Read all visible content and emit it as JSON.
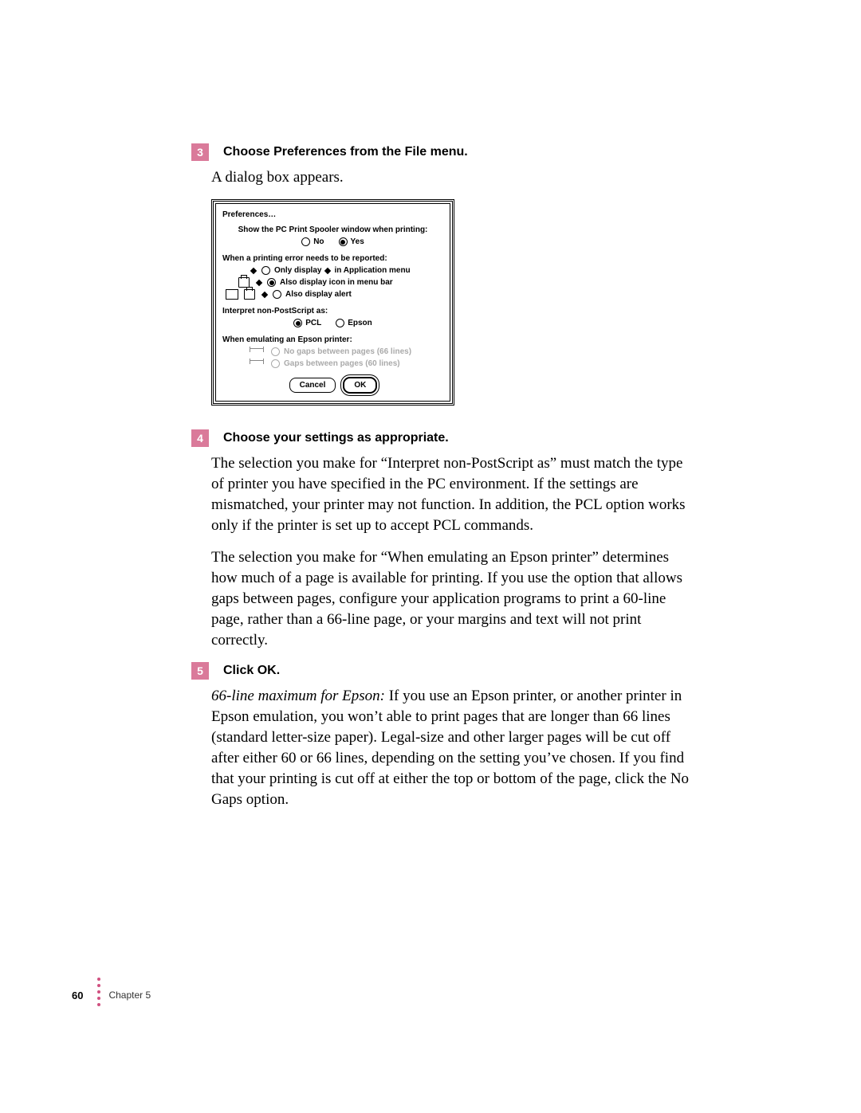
{
  "steps": {
    "s3": {
      "num": "3",
      "title": "Choose Preferences from the File menu.",
      "line1": "A dialog box appears."
    },
    "s4": {
      "num": "4",
      "title": "Choose your settings as appropriate.",
      "p1": "The selection you make for “Interpret non-PostScript as” must match the type of printer you have specified in the PC environment. If the settings are mismatched, your printer may not function. In addition, the PCL option works only if the printer is set up to accept PCL commands.",
      "p2": "The selection you make for “When emulating an Epson printer” determines how much of a page is available for printing. If you use the option that allows gaps between pages, configure your application programs to print a 60-line page, rather than a 66-line page, or your margins and text will not print correctly."
    },
    "s5": {
      "num": "5",
      "title": "Click OK.",
      "noteLabel": "66-line maximum for Epson:",
      "noteBody": "  If you use an Epson printer, or another printer in Epson emulation, you won’t able to print pages that are longer than 66 lines (standard letter-size paper). Legal-size and other larger pages will be cut off after either 60 or 66 lines, depending on the setting you’ve chosen. If you find that your printing is cut off at either the top or bottom of the page, click the No Gaps option."
    }
  },
  "dialog": {
    "title": "Preferences…",
    "q1": "Show the PC Print Spooler window when printing:",
    "no": "No",
    "yes": "Yes",
    "q2": "When a printing error needs to be reported:",
    "opt2a": "Only display      in Application menu",
    "opt2b": "Also display icon in menu bar",
    "opt2c": "Also display alert",
    "q3": "Interpret non-PostScript as:",
    "pcl": "PCL",
    "epson": "Epson",
    "q4": "When emulating an Epson printer:",
    "opt4a": "No gaps between pages (66 lines)",
    "opt4b": "Gaps between pages (60 lines)",
    "cancel": "Cancel",
    "ok": "OK"
  },
  "footer": {
    "page": "60",
    "chapter": "Chapter 5"
  }
}
